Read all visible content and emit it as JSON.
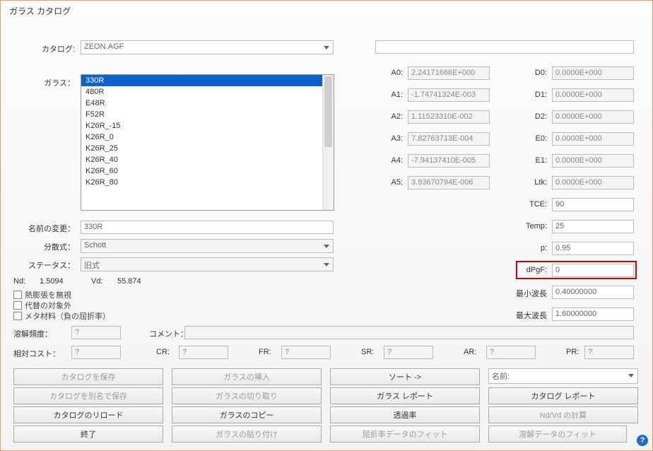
{
  "title": "ガラス カタログ",
  "labels": {
    "catalog": "カタログ:",
    "glass": "ガラス：",
    "rename": "名前の変更：",
    "dispersion": "分散式：",
    "status": "ステータス：",
    "nd": "Nd:",
    "vd": "Vd:",
    "chk_ignore": "熱膨張を無視",
    "chk_exclude": "代替の対象外",
    "chk_meta": "メタ材料（負の屈折率）",
    "meltfreq": "溶解頻度：",
    "comment": "コメント：",
    "relcost": "相対コスト：",
    "cr": "CR:",
    "fr": "FR:",
    "sr": "SR:",
    "ar": "AR:",
    "pr": "PR:",
    "A0": "A0:",
    "A1": "A1:",
    "A2": "A2:",
    "A3": "A3:",
    "A4": "A4:",
    "A5": "A5:",
    "D0": "D0:",
    "D1": "D1:",
    "D2": "D2:",
    "E0": "E0:",
    "E1": "E1:",
    "Ltk": "Ltk:",
    "TCE": "TCE:",
    "Temp": "Temp:",
    "p": "p:",
    "dPgF": "dPgF:",
    "minwave": "最小波長",
    "maxwave": "最大波長"
  },
  "catalog": "ZEON.AGF",
  "glass_list": [
    "330R",
    "480R",
    "E48R",
    "F52R",
    "K26R_-15",
    "K26R_0",
    "K26R_25",
    "K26R_40",
    "K26R_60",
    "K26R_80"
  ],
  "rename_value": "330R",
  "dispersion_value": "Schott",
  "status_value": "旧式",
  "nd_value": "1.5094",
  "vd_value": "55.874",
  "meltfreq_value": "?",
  "comment_value": "",
  "relcost_value": "?",
  "cr_v": "?",
  "fr_v": "?",
  "sr_v": "?",
  "ar_v": "?",
  "pr_v": "?",
  "coeffs": {
    "A0": "2.24171666E+000",
    "A1": "-1.74741324E-003",
    "A2": "1.11523310E-002",
    "A3": "7.82763713E-004",
    "A4": "-7.94137410E-005",
    "A5": "3.93670794E-006",
    "D0": "0.0000E+000",
    "D1": "0.0000E+000",
    "D2": "0.0000E+000",
    "E0": "0.0000E+000",
    "E1": "0.0000E+000",
    "Ltk": "0.0000E+000",
    "TCE": "90",
    "Temp": "25",
    "p": "0.95",
    "dPgF": "0",
    "minwave": "0.40000000",
    "maxwave": "1.60000000"
  },
  "buttons": {
    "save": "カタログを保存",
    "insert": "ガラスの挿入",
    "sort": "ソート ->",
    "name": "名前:",
    "saveas": "カタログを別名で保存",
    "cut": "ガラスの切り取り",
    "glassrep": "ガラス レポート",
    "catrep": "カタログ レポート",
    "reload": "カタログのリロード",
    "copy": "ガラスのコピー",
    "trans": "透過率",
    "ndvd": "Nd/Vd の計算",
    "exit": "終了",
    "paste": "ガラスの貼り付け",
    "fitindex": "屈折率データのフィット",
    "fitmelt": "溶解データのフィット"
  }
}
